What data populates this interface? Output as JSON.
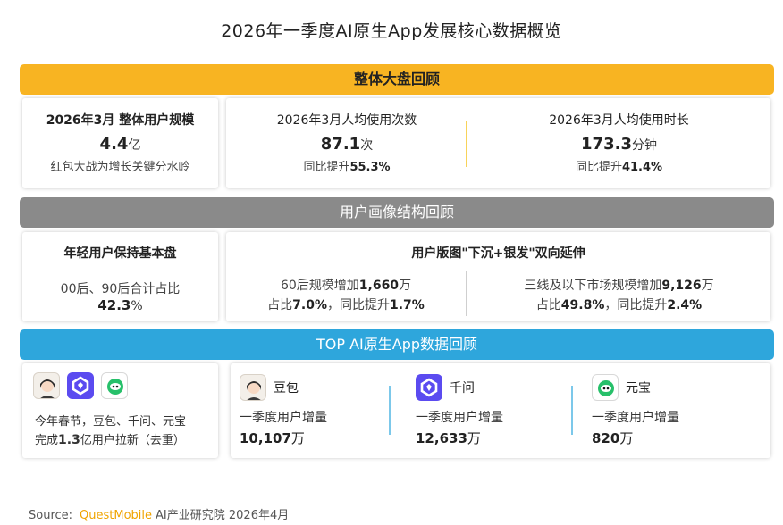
{
  "title": "2026年一季度AI原生App发展核心数据概览",
  "colors": {
    "section1": "#f8b422",
    "section2": "#8a8a8a",
    "section3": "#2ea6dc",
    "brand_questmobile": "#f0a400"
  },
  "section1": {
    "header": "整体大盘回顾",
    "card1": {
      "title": "2026年3月 整体用户规模",
      "value": "4.4",
      "unit": "亿",
      "note": "红包大战为增长关键分水岭"
    },
    "card2": {
      "title": "2026年3月人均使用次数",
      "value": "87.1",
      "unit": "次",
      "yoy_label": "同比提升",
      "yoy_value": "55.3%"
    },
    "card3": {
      "title": "2026年3月人均使用时长",
      "value": "173.3",
      "unit": "分钟",
      "yoy_label": "同比提升",
      "yoy_value": "41.4%"
    }
  },
  "section2": {
    "header": "用户画像结构回顾",
    "card1": {
      "title": "年轻用户保持基本盘",
      "line1": "00后、90后合计占比",
      "value": "42.3",
      "unit": "%"
    },
    "card2": {
      "title": "用户版图\"下沉+银发\"双向延伸",
      "left": {
        "label": "60后规模增加",
        "value": "1,660",
        "unit": "万",
        "share_label": "占比",
        "share_value": "7.0%",
        "yoy_label": "，同比提升",
        "yoy_value": "1.7%"
      },
      "right": {
        "label": "三线及以下市场规模增加",
        "value": "9,126",
        "unit": "万",
        "share_label": "占比",
        "share_value": "49.8%",
        "yoy_label": "，同比提升",
        "yoy_value": "2.4%"
      }
    }
  },
  "section3": {
    "header": "TOP AI原生App数据回顾",
    "summary": {
      "line1": "今年春节，豆包、千问、元宝",
      "line2_prefix": "完成",
      "value": "1.3",
      "line2_suffix": "亿用户拉新（去重）"
    },
    "apps": [
      {
        "name": "豆包",
        "icon": "doubao-icon",
        "metric": "一季度用户增量",
        "value": "10,107",
        "unit": "万"
      },
      {
        "name": "千问",
        "icon": "qianwen-icon",
        "metric": "一季度用户增量",
        "value": "12,633",
        "unit": "万"
      },
      {
        "name": "元宝",
        "icon": "yuanbao-icon",
        "metric": "一季度用户增量",
        "value": "820",
        "unit": "万"
      }
    ]
  },
  "source": {
    "label": "Source:",
    "brand": "QuestMobile",
    "text": "AI产业研究院 2026年4月"
  }
}
